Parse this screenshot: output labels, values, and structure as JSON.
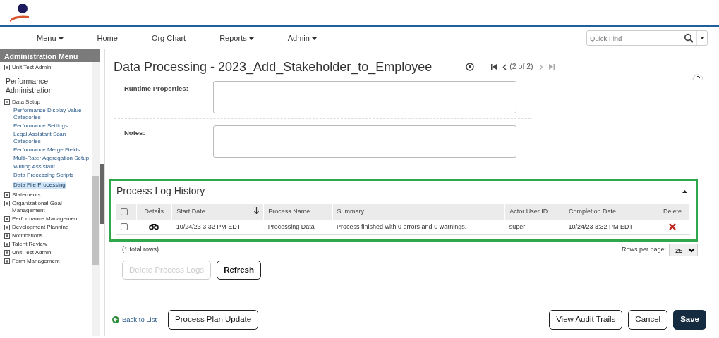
{
  "nav": [
    {
      "label": "Menu",
      "dropdown": true
    },
    {
      "label": "Home",
      "dropdown": false
    },
    {
      "label": "Org Chart",
      "dropdown": false
    },
    {
      "label": "Reports",
      "dropdown": true
    },
    {
      "label": "Admin",
      "dropdown": true
    }
  ],
  "quick_find": {
    "placeholder": "Quick Find"
  },
  "sidebar": {
    "title": "Administration Menu",
    "items": [
      {
        "kind": "node",
        "label": "Unit Test Admin",
        "expanded": false
      },
      {
        "kind": "heading",
        "label": "Performance Administration"
      },
      {
        "kind": "node",
        "label": "Data Setup",
        "expanded": true,
        "children": [
          {
            "label": "Performance Display Value Categories",
            "selected": false
          },
          {
            "label": "Performance Settings",
            "selected": false
          },
          {
            "label": "Legal Assistant Scan Categories",
            "selected": false
          },
          {
            "label": "Performance Merge Fields",
            "selected": false
          },
          {
            "label": "Multi-Rater Aggregation Setup",
            "selected": false
          },
          {
            "label": "Writing Assistant",
            "selected": false
          },
          {
            "label": "Data Processing Scripts",
            "selected": false
          },
          {
            "label": "Data File Processing",
            "selected": true
          }
        ]
      },
      {
        "kind": "node",
        "label": "Statements",
        "expanded": false
      },
      {
        "kind": "node",
        "label": "Organizational Goal Management",
        "expanded": false
      },
      {
        "kind": "node",
        "label": "Performance Management",
        "expanded": false
      },
      {
        "kind": "node",
        "label": "Development Planning",
        "expanded": false
      },
      {
        "kind": "node",
        "label": "Notifications",
        "expanded": false
      },
      {
        "kind": "node",
        "label": "Talent Review",
        "expanded": false
      },
      {
        "kind": "node",
        "label": "Unit Test Admin",
        "expanded": false
      },
      {
        "kind": "node",
        "label": "Form Management",
        "expanded": false
      }
    ]
  },
  "page": {
    "title": "Data Processing - 2023_Add_Stakeholder_to_Employee",
    "pager": "(2 of 2)"
  },
  "fields": [
    {
      "label": "Runtime Properties:"
    },
    {
      "label": "Notes:"
    }
  ],
  "log": {
    "title": "Process Log History",
    "expanded": true,
    "columns": [
      {
        "label": "Details"
      },
      {
        "label": "Start Date",
        "sorted": true
      },
      {
        "label": "Process Name"
      },
      {
        "label": "Summary"
      },
      {
        "label": "Actor User ID"
      },
      {
        "label": "Completion Date"
      },
      {
        "label": "Delete"
      }
    ],
    "all_checked": false,
    "rows": [
      {
        "checked": false,
        "start_date": "10/24/23 3:32 PM EDT",
        "process_name": "Processing Data",
        "summary": "Process finished with 0 errors and 0 warnings.",
        "actor": "super",
        "completion_date": "10/24/23 3:32 PM EDT"
      }
    ],
    "total": "(1 total rows)",
    "rows_per_page_label": "Rows per page:",
    "rows_per_page": "25",
    "buttons": [
      {
        "label": "Delete Process Logs",
        "disabled": true
      },
      {
        "label": "Refresh",
        "disabled": false
      }
    ]
  },
  "footer": {
    "back_link": "Back to List",
    "left_buttons": [
      {
        "label": "Process Plan Update",
        "kind": "outline"
      }
    ],
    "right_buttons": [
      {
        "label": "View Audit Trails",
        "kind": "outline"
      },
      {
        "label": "Cancel",
        "kind": "outline"
      },
      {
        "label": "Save",
        "kind": "primary"
      }
    ]
  }
}
